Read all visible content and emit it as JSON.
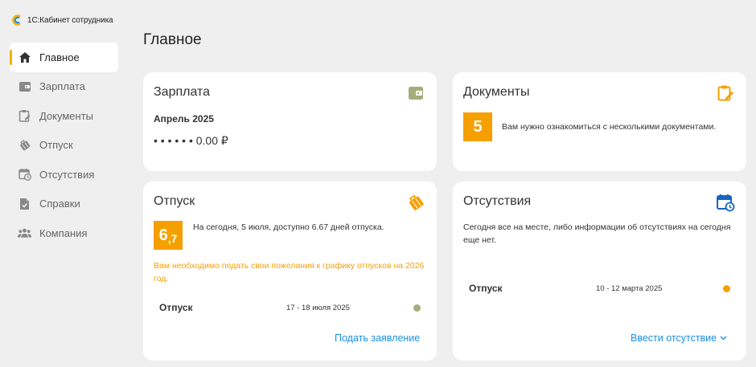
{
  "app": {
    "title": "1С:Кабинет сотрудника"
  },
  "page": {
    "title": "Главное"
  },
  "sidebar": {
    "items": [
      {
        "label": "Главное",
        "icon": "home-icon",
        "active": true
      },
      {
        "label": "Зарплата",
        "icon": "wallet-icon"
      },
      {
        "label": "Документы",
        "icon": "clipboard-icon"
      },
      {
        "label": "Отпуск",
        "icon": "suitcase-icon"
      },
      {
        "label": "Отсутствия",
        "icon": "calendar-clock-icon"
      },
      {
        "label": "Справки",
        "icon": "document-icon"
      },
      {
        "label": "Компания",
        "icon": "people-icon"
      }
    ]
  },
  "salary": {
    "title": "Зарплата",
    "period": "Апрель 2025",
    "amount": "• • •   • • • 0.00 ₽",
    "icon": "wallet-icon"
  },
  "documents": {
    "title": "Документы",
    "count": "5",
    "text": "Вам нужно ознакомиться с несколькими документами.",
    "icon": "clipboard-edit-icon"
  },
  "vacation": {
    "title": "Отпуск",
    "days_big": "6",
    "days_small": ",7",
    "text": "На сегодня, 5 июля, доступно 6.67 дней отпуска.",
    "warning": "Вам необходимо подать свои пожелания к графику отпусков на 2026 год.",
    "row_label": "Отпуск",
    "row_dates": "17 - 18 июля 2025",
    "action": "Подать заявление",
    "icon": "suitcase-icon"
  },
  "absences": {
    "title": "Отсутствия",
    "text": "Сегодня все на месте, либо информации об отсутствиях на сегодня еще нет.",
    "row_label": "Отпуск",
    "row_dates": "10 - 12 марта 2025",
    "action": "Ввести отсутствие",
    "icon": "calendar-clock-icon"
  },
  "colors": {
    "accent": "#f5a000",
    "link": "#1a8fe3",
    "olive": "#a5ad7a",
    "navy": "#1565c0"
  }
}
